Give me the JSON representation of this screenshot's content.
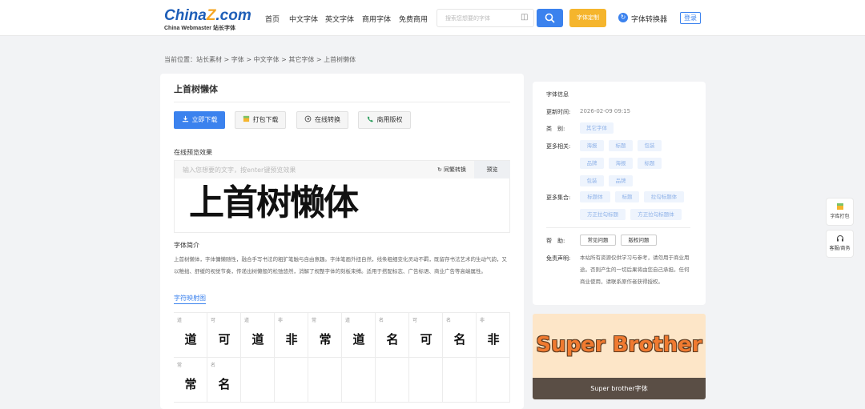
{
  "header": {
    "logo_main": "ChinaZ.com",
    "logo_sub": "China Webmaster 站长字体",
    "nav": [
      "首页",
      "中文字体",
      "英文字体",
      "商用字体",
      "免费商用"
    ],
    "search_placeholder": "搜索您想要的字体",
    "custom_label": "字体定制",
    "converter_label": "字体转换器",
    "login_label": "登录"
  },
  "breadcrumb": "当前位置：站长素材 > 字体 > 中文字体 > 其它字体 > 上首树懒体",
  "font": {
    "title": "上首树懒体",
    "actions": [
      "立即下载",
      "打包下载",
      "在线转换",
      "商用版权"
    ],
    "preview_label": "在线预览效果",
    "preview_placeholder": "输入您想要的文字，按enter键预览效果",
    "convert_label": "同繁转换",
    "preview_button": "预览",
    "preview_text": "上首树懒体",
    "intro_label": "字体简介",
    "intro_text": "上首树懒体，字体慵懒随性，融合手写书法的粗犷笔触与自由意趣。字体笔画外扭自然，线条粗细变化灵动不羁，既留存书法艺术的生动气韵，又以稚拙、舒缓的视觉节奏，传递出树懒般的松弛悠然，消解了规整字体的刻板束缚。适用于搭配标志、广告标语、商业广告等高端属性。",
    "map_link": "字符映射图",
    "chars": [
      {
        "small": "道",
        "big": "道"
      },
      {
        "small": "可",
        "big": "可"
      },
      {
        "small": "道",
        "big": "道"
      },
      {
        "small": "非",
        "big": "非"
      },
      {
        "small": "常",
        "big": "常"
      },
      {
        "small": "道",
        "big": "道"
      },
      {
        "small": "名",
        "big": "名"
      },
      {
        "small": "可",
        "big": "可"
      },
      {
        "small": "名",
        "big": "名"
      },
      {
        "small": "非",
        "big": "非"
      },
      {
        "small": "常",
        "big": "常"
      },
      {
        "small": "名",
        "big": "名"
      }
    ]
  },
  "info": {
    "heading": "字体信息",
    "updated_label": "更新时间:",
    "updated_value": "2026-02-09 09:15",
    "category_label": "类　别:",
    "category_value": "其它字体",
    "related_label": "更多相关:",
    "related": [
      "海报",
      "标题",
      "包装",
      "品牌",
      "海报",
      "标题",
      "包装",
      "品牌"
    ],
    "collections_label": "更多集合:",
    "collections": [
      "标题体",
      "标题",
      "拉勾标题体",
      "方正拉勾标题",
      "方正拉勾标题体"
    ],
    "help_label": "帮　助:",
    "help_buttons": [
      "常见问题",
      "版权问题"
    ],
    "disclaimer_label": "免责声明:",
    "disclaimer_text": "本站所有资源仅供学习与参考，请勿用于商业用途。否则产生的一切后果将由您自己承担。任何商业使用，请联系原作者获得授权。"
  },
  "ad": {
    "art_text": "Super Brother",
    "caption": "Super brother字体"
  },
  "float": [
    "字库打包",
    "客服/商务"
  ],
  "colors": {
    "accent": "#3b82ee",
    "custom": "#f5b52d",
    "brand": "#1f5fb8"
  }
}
